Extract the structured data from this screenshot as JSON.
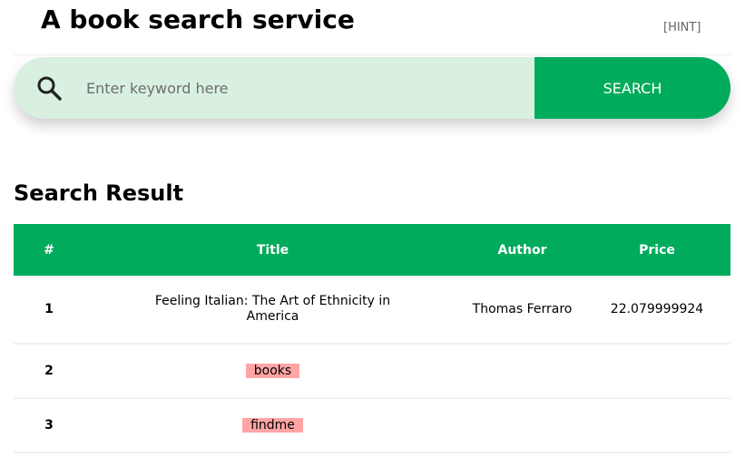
{
  "header": {
    "title": "A book search service",
    "hint_label": "[HINT]"
  },
  "search": {
    "placeholder": "Enter keyword here",
    "value": "",
    "button_label": "SEARCH",
    "icon": "search-icon"
  },
  "results": {
    "title": "Search Result",
    "columns": [
      "#",
      "Title",
      "Author",
      "Price"
    ],
    "rows": [
      {
        "num": "1",
        "title": "Feeling Italian: The Art of Ethnicity in America",
        "author": "Thomas Ferraro",
        "price": "22.079999924"
      },
      {
        "num": "2",
        "title": "books",
        "author": "",
        "price": ""
      },
      {
        "num": "3",
        "title": "findme",
        "author": "",
        "price": ""
      }
    ]
  },
  "colors": {
    "accent": "#00ab5c",
    "search_bg": "#d9f0e1",
    "highlight": "#ffa5a5"
  }
}
